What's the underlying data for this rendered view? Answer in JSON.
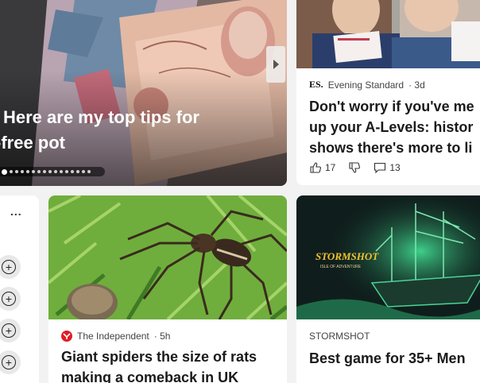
{
  "hero": {
    "title_line1": "Here are my top tips for",
    "title_line2": "-free pot",
    "dots_total": 16,
    "dots_active_index": 0,
    "next_icon": "chevron-right-icon"
  },
  "es_card": {
    "logo": "ES.",
    "source": "Evening Standard",
    "age": "· 3d",
    "title_line1": "Don't worry if you've me",
    "title_line2": "up your A-Levels: histor",
    "title_line3": "shows there's more to li",
    "likes": "17",
    "comments": "13"
  },
  "sidebar": {
    "more_label": "...",
    "add_icon": "plus-circle-icon"
  },
  "spider_card": {
    "source": "The Independent",
    "age": "· 5h",
    "title_line1": "Giant spiders the size of rats",
    "title_line2": "making a comeback in UK"
  },
  "storm_card": {
    "image_logo": "STORMSHOT",
    "image_tagline": "ISLE OF ADVENTURE",
    "source": "STORMSHOT",
    "title": "Best game for 35+ Men"
  },
  "colors": {
    "page_bg": "#f2f2f2",
    "independent_red": "#e01c24",
    "stormshot_gold": "#f2c230"
  }
}
